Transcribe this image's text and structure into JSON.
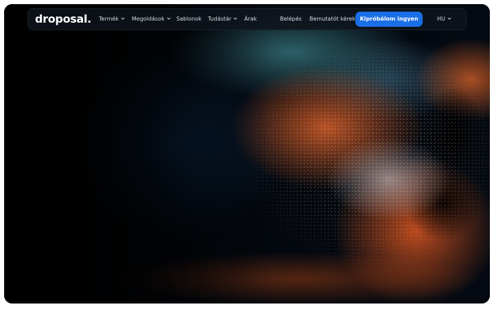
{
  "brand": {
    "logo_text": "droposal."
  },
  "nav": {
    "items": [
      {
        "label": "Termék",
        "has_dropdown": true
      },
      {
        "label": "Megoldások",
        "has_dropdown": true
      },
      {
        "label": "Sablonok",
        "has_dropdown": false
      },
      {
        "label": "Tudástár",
        "has_dropdown": true
      },
      {
        "label": "Árak",
        "has_dropdown": false
      }
    ],
    "login_label": "Belépés",
    "demo_label": "Bemutatót kérek",
    "cta_label": "Kipróbálom ingyen",
    "language_label": "HU"
  },
  "colors": {
    "cta_background": "#1b6fe6",
    "navbar_background": "#0e141c",
    "page_background": "#000000"
  },
  "icons": {
    "dropdown": "chevron-down-icon"
  }
}
